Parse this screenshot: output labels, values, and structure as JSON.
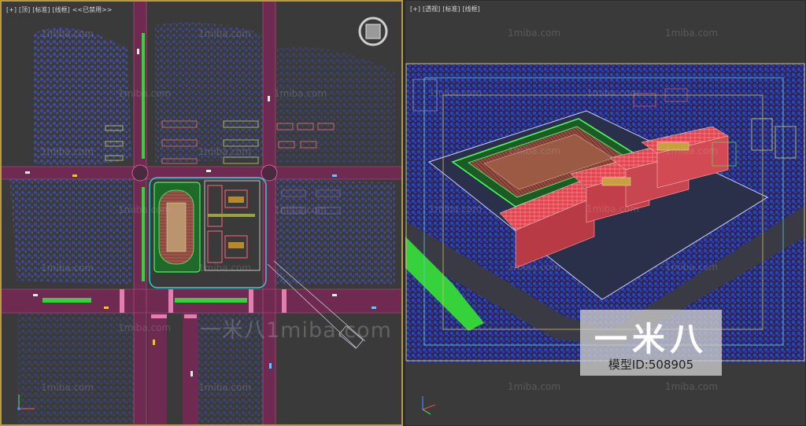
{
  "left_viewport": {
    "label_parts": [
      "[+]",
      "[顶]",
      "[标准]",
      "[线框]",
      "<<已禁用>>"
    ]
  },
  "right_viewport": {
    "label_parts": [
      "[+]",
      "[透视]",
      "[标准]",
      "[线框]"
    ]
  },
  "watermark": {
    "small_text": "1miba.com",
    "big_text": "一米八1miba.com"
  },
  "brand": {
    "logo_text": "一米八",
    "id_label": "模型ID:508905"
  },
  "colors": {
    "active_border": "#b69a4a",
    "viewport_bg": "#3a3a3a",
    "road": "#7a2f55",
    "field": "#2ad23a",
    "track": "#a2544a",
    "building": "#ff5a66",
    "trees": "#3a4fd0"
  },
  "icons": [
    "viewcube-icon",
    "axis-gizmo-icon"
  ]
}
